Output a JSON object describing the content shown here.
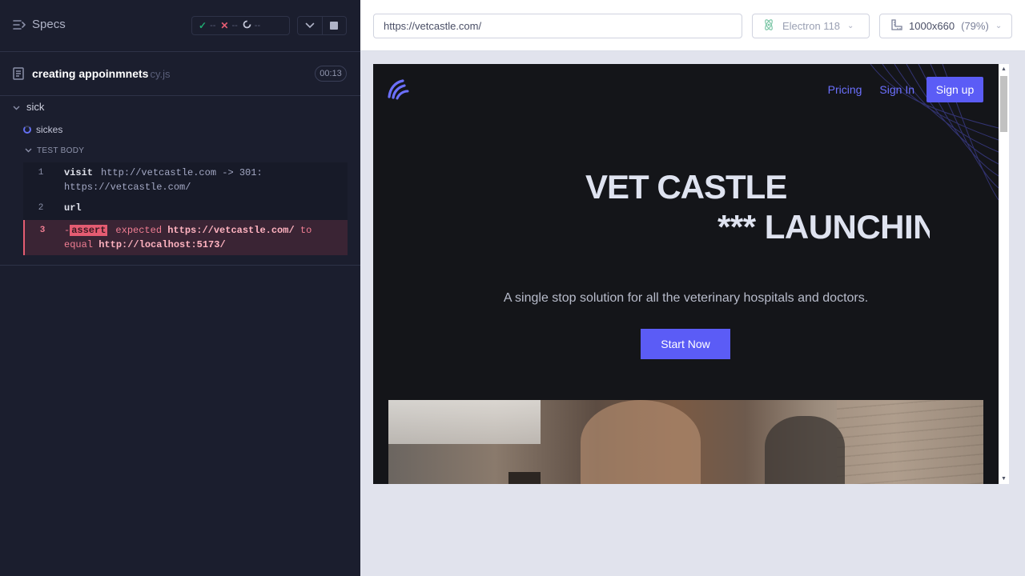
{
  "reporter": {
    "specs_label": "Specs",
    "stats": {
      "passed": "--",
      "failed": "--",
      "pending": "--"
    },
    "spec": {
      "name": "creating appoinmnets",
      "ext": "cy.js",
      "duration": "00:13"
    },
    "suite": {
      "title": "sick"
    },
    "test": {
      "title": "sickes"
    },
    "body_label": "TEST BODY",
    "commands": [
      {
        "num": "1",
        "name": "visit",
        "message_line1": "http://vetcastle.com -> 301:",
        "message_line2": "https://vetcastle.com/"
      },
      {
        "num": "2",
        "name": "url"
      },
      {
        "num": "3",
        "prefix": "-",
        "name": "assert",
        "expected_word": "expected",
        "expected_value": "https://vetcastle.com/",
        "to_word": "to",
        "equal_word": "equal",
        "actual_value": "http://localhost:5173/"
      }
    ]
  },
  "toolbar": {
    "url": "https://vetcastle.com/",
    "browser": "Electron 118",
    "viewport_size": "1000x660",
    "viewport_scale": "(79%)"
  },
  "aut": {
    "nav": {
      "pricing": "Pricing",
      "signin": "Sign In",
      "signup": "Sign up"
    },
    "hero_line1": "VET CASTLE",
    "hero_line2": "*** LAUNCHING SOON",
    "tagline": "A single stop solution for all the veterinary hospitals and doctors.",
    "cta": "Start Now"
  },
  "colors": {
    "reporter_bg": "#1b1e2e",
    "accent": "#5b5cf6",
    "error": "#e55c72",
    "pass": "#1fa971"
  }
}
